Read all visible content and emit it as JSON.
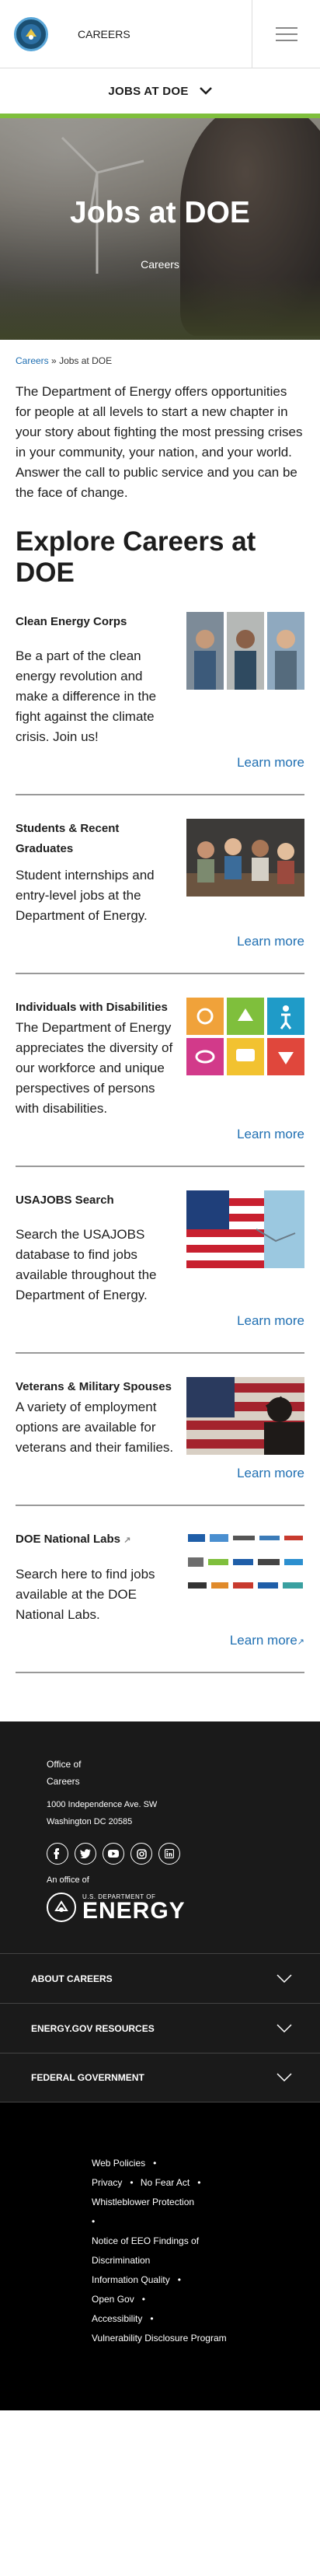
{
  "header": {
    "site_name": "CAREERS",
    "section_label": "JOBS AT DOE"
  },
  "hero": {
    "title": "Jobs at DOE",
    "subtitle": "Careers"
  },
  "breadcrumb": {
    "home": "Careers",
    "separator": "»",
    "current": "Jobs at DOE"
  },
  "intro": "The Department of Energy offers opportunities for people at all levels to start a new chapter in your story about fighting the most pressing crises in your community, your nation, and your world. Answer the call to public service and you can be the face of change.",
  "explore_heading": "Explore Careers at DOE",
  "cards": [
    {
      "title": "Clean Energy Corps",
      "body": "Be a part of the clean energy revolution and make a difference in the fight against the climate crisis. Join us!",
      "link": "Learn more"
    },
    {
      "title": "Students & Recent Graduates",
      "body": "Student internships and entry-level jobs at the Department of Energy.",
      "link": "Learn more"
    },
    {
      "title": "Individuals with Disabilities",
      "body": "The Department of Energy appreciates the diversity of our workforce and unique perspectives of persons with disabilities.",
      "link": "Learn more"
    },
    {
      "title": "USAJOBS Search",
      "body": "Search the USAJOBS database to find jobs available throughout the Department of Energy.",
      "link": "Learn more"
    },
    {
      "title": "Veterans & Military Spouses",
      "body": "A variety of employment options are available for veterans and their families.",
      "link": "Learn more"
    },
    {
      "title": "DOE National Labs",
      "body": "Search here to find jobs available at the DOE National Labs.",
      "link": "Learn more"
    }
  ],
  "footer": {
    "office_line1": "Office of",
    "office_line2": "Careers",
    "address_line1": "1000 Independence Ave. SW",
    "address_line2": "Washington DC 20585",
    "office_of_label": "An office of",
    "logo_small": "U.S. DEPARTMENT OF",
    "logo_big": "ENERGY",
    "accordion": [
      "ABOUT CAREERS",
      "ENERGY.GOV RESOURCES",
      "FEDERAL GOVERNMENT"
    ],
    "links": [
      "Web Policies",
      "Privacy",
      "No Fear Act",
      "Whistleblower Protection",
      "Notice of EEO Findings of Discrimination",
      "Information Quality",
      "Open Gov",
      "Accessibility",
      "Vulnerability Disclosure Program"
    ]
  },
  "colors": {
    "accent_green": "#7fbf3c",
    "link_blue": "#1f6fb2",
    "footer_bg": "#1a1a1a",
    "bottom_bg": "#000000"
  },
  "icons": {
    "menu": "hamburger-icon",
    "chevron": "chevron-down-icon",
    "social": [
      "facebook-icon",
      "twitter-icon",
      "youtube-icon",
      "instagram-icon",
      "linkedin-icon"
    ]
  }
}
